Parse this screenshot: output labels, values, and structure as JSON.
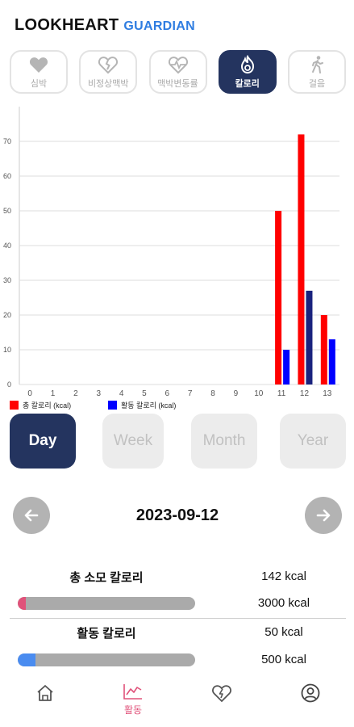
{
  "header": {
    "title": "LOOKHEART",
    "subtitle": "GUARDIAN"
  },
  "tabs": [
    {
      "label": "심박",
      "icon": "heart-icon",
      "active": false
    },
    {
      "label": "비정상맥박",
      "icon": "broken-heart-icon",
      "active": false
    },
    {
      "label": "맥박변동률",
      "icon": "heartbeat-pulse-icon",
      "active": false
    },
    {
      "label": "칼로리",
      "icon": "flame-icon",
      "active": true
    },
    {
      "label": "걸음",
      "icon": "walking-icon",
      "active": false
    }
  ],
  "chart_data": {
    "type": "bar",
    "categories": [
      "0",
      "1",
      "2",
      "3",
      "4",
      "5",
      "6",
      "7",
      "8",
      "9",
      "10",
      "11",
      "12",
      "13"
    ],
    "series": [
      {
        "name": "총 칼로리 (kcal)",
        "color": "#ff0000",
        "values": [
          0,
          0,
          0,
          0,
          0,
          0,
          0,
          0,
          0,
          0,
          0,
          50,
          72,
          20
        ]
      },
      {
        "name": "활동 칼로리 (kcal)",
        "color": "#0000ff",
        "values": [
          0,
          0,
          0,
          0,
          0,
          0,
          0,
          0,
          0,
          0,
          0,
          10,
          27,
          13
        ]
      }
    ],
    "highlight_color": "#1a237e",
    "yticks": [
      0,
      10,
      20,
      30,
      40,
      50,
      60,
      70
    ],
    "ylim": [
      0,
      80
    ],
    "grid": true,
    "legend": "bottom-left"
  },
  "ranges": [
    {
      "label": "Day",
      "active": true
    },
    {
      "label": "Week",
      "active": false
    },
    {
      "label": "Month",
      "active": false
    },
    {
      "label": "Year",
      "active": false
    }
  ],
  "date": "2023-09-12",
  "stats": {
    "total_label": "총 소모 칼로리",
    "total_value": "142 kcal",
    "total_goal": "3000 kcal",
    "total_ratio": 0.047,
    "total_color": "#e0527a",
    "active_label": "활동 칼로리",
    "active_value": "50 kcal",
    "active_goal": "500 kcal",
    "active_ratio": 0.1,
    "active_color": "#4a8cf0"
  },
  "bottom_nav": [
    {
      "icon": "home-icon",
      "label": ""
    },
    {
      "icon": "activity-chart-icon",
      "label": "활동"
    },
    {
      "icon": "heart-bolt-icon",
      "label": ""
    },
    {
      "icon": "profile-icon",
      "label": ""
    }
  ]
}
